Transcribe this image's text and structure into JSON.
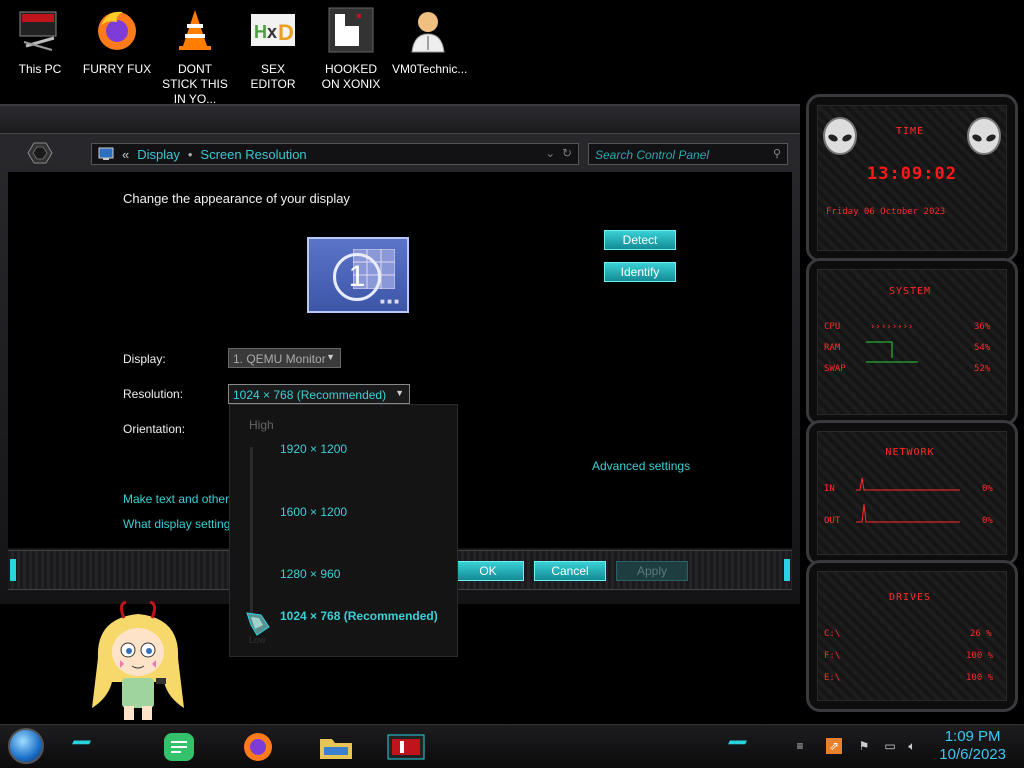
{
  "desktop": {
    "icons": [
      {
        "label": "This PC"
      },
      {
        "label": "FURRY FUX"
      },
      {
        "label": "DONT STICK THIS IN YO..."
      },
      {
        "label": "SEX EDITOR"
      },
      {
        "label": "HOOKED ON XONIX"
      },
      {
        "label": "VM0Technic..."
      }
    ]
  },
  "window": {
    "breadcrumb": {
      "back": "«",
      "display": "Display",
      "screen_resolution": "Screen Resolution"
    },
    "search_placeholder": "Search Control Panel",
    "heading": "Change the appearance of your display",
    "monitor_number": "1",
    "detect_label": "Detect",
    "identify_label": "Identify",
    "display_label": "Display:",
    "display_value": "1. QEMU Monitor",
    "resolution_label": "Resolution:",
    "resolution_value": "1024 × 768 (Recommended)",
    "orientation_label": "Orientation:",
    "advanced_settings": "Advanced settings",
    "link_text_size": "Make text and other",
    "link_display_settings": "What display setting",
    "ok_label": "OK",
    "cancel_label": "Cancel",
    "apply_label": "Apply"
  },
  "resolution_dropdown": {
    "high_label": "High",
    "options": [
      "1920 × 1200",
      "1600 × 1200",
      "1280 × 960",
      "1024 × 768 (Recommended)"
    ],
    "selected": "1024 × 768 (Recommended)",
    "low_label": "Low"
  },
  "gadgets": {
    "time": {
      "title": "TIME",
      "clock": "13:09:02",
      "date": "Friday 06 October 2023"
    },
    "system": {
      "title": "SYSTEM",
      "rows": [
        {
          "label": "CPU",
          "value": "36%"
        },
        {
          "label": "RAM",
          "value": "54%"
        },
        {
          "label": "SWAP",
          "value": "52%"
        }
      ]
    },
    "network": {
      "title": "NETWORK",
      "rows": [
        {
          "label": "IN",
          "value": "0%"
        },
        {
          "label": "OUT",
          "value": "0%"
        }
      ]
    },
    "drives": {
      "title": "DRIVES",
      "rows": [
        {
          "label": "C:\\",
          "value": "26 %"
        },
        {
          "label": "F:\\",
          "value": "100 %"
        },
        {
          "label": "E:\\",
          "value": "100 %"
        }
      ]
    }
  },
  "taskbar": {
    "time": "1:09 PM",
    "date": "10/6/2023"
  },
  "colors": {
    "accent": "#3ad0d6",
    "gadget_red": "#ff2a2a",
    "clock_blue": "#3ac8f0"
  }
}
